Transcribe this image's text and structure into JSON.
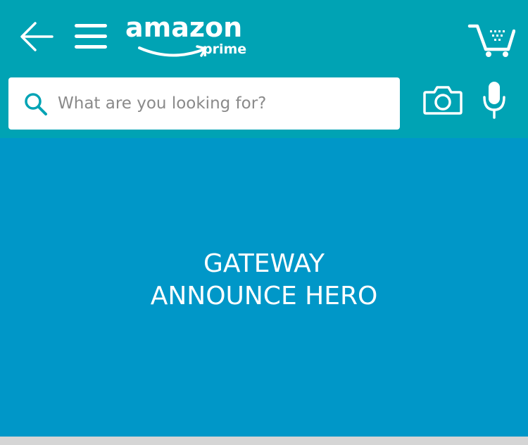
{
  "header": {
    "back_icon": "arrow-left-icon",
    "menu_icon": "hamburger-menu-icon",
    "logo": {
      "wordmark": "amazon",
      "subtitle": "prime"
    },
    "cart_icon": "shopping-cart-icon"
  },
  "search": {
    "placeholder": "What are you looking for?",
    "value": "",
    "search_icon": "magnifier-icon",
    "camera_icon": "camera-icon",
    "mic_icon": "microphone-icon"
  },
  "hero": {
    "line1": "GATEWAY",
    "line2": "ANNOUNCE HERO"
  },
  "colors": {
    "header_bg": "#00a3b4",
    "hero_bg": "#0097c8",
    "search_icon": "#00a3b4",
    "bottom_strip": "#d5d5d5"
  }
}
